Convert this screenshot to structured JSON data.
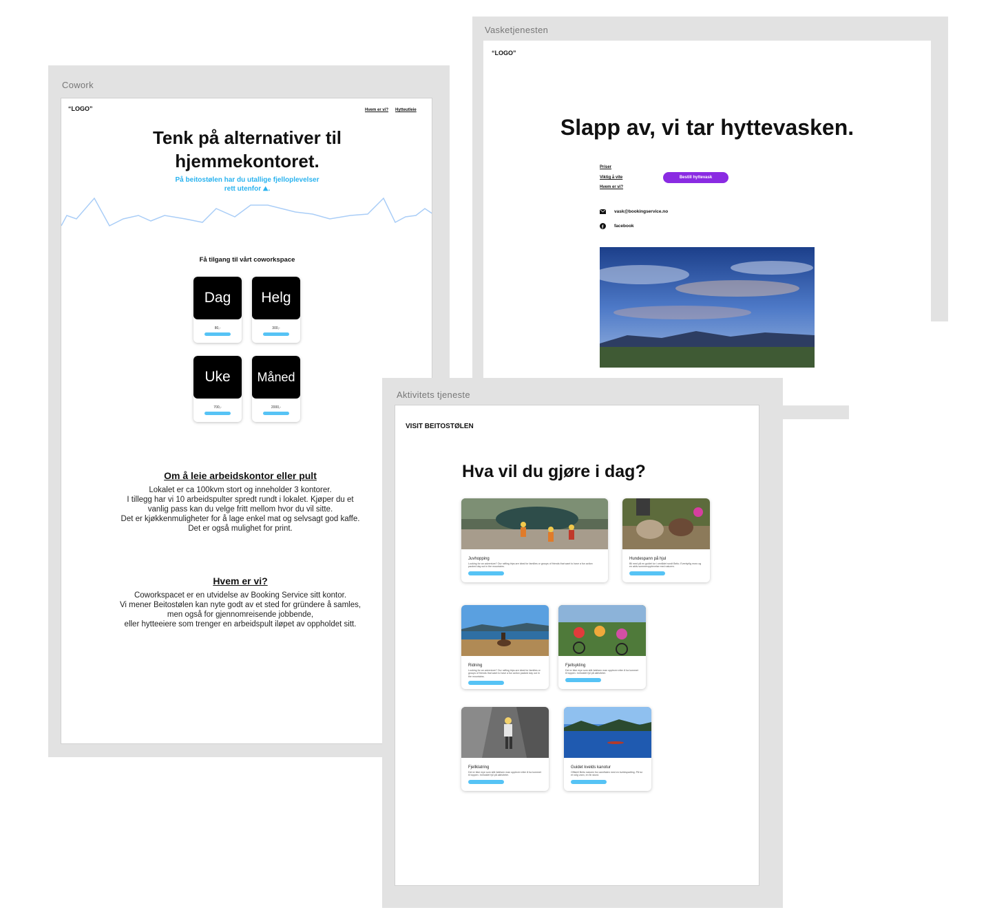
{
  "cowork": {
    "frame_title": "Cowork",
    "logo": "“LOGO”",
    "nav": [
      "Hvem er vi?",
      "Hytteutleie"
    ],
    "headline_line1": "Tenk på alternativer til",
    "headline_line2": "hjemmekontoret.",
    "subtitle_line1": "På beitostølen har du utallige fjelloplevelser",
    "subtitle_line2": "rett utenfor",
    "subtitle_end": ".",
    "access_heading": "Få tilgang til vårt coworkspace",
    "plans": [
      {
        "name": "Dag",
        "price": "80,-"
      },
      {
        "name": "Helg",
        "price": "300,-"
      },
      {
        "name": "Uke",
        "price": "700,-"
      },
      {
        "name": "Måned",
        "price": "2000,-"
      }
    ],
    "about_heading": "Om å leie arbeidskontor eller pult",
    "about_lines": [
      "Lokalet er ca 100kvm stort og inneholder 3 kontorer.",
      "I tillegg har vi 10 arbeidspulter spredt rundt i lokalet. Kjøper du et",
      "vanlig pass kan du velge fritt mellom hvor du vil sitte.",
      "Det er kjøkkenmuligheter for å lage enkel mat og selvsagt god kaffe.",
      "Det er også mulighet for print."
    ],
    "who_heading": "Hvem er vi?",
    "who_lines": [
      "Coworkspacet er en utvidelse av Booking Service sitt kontor.",
      "Vi mener Beitostølen kan nyte godt av et sted for gründere å samles,",
      "men også for gjennomreisende jobbende,",
      "eller hytteeiere som trenger en arbeidspult iløpet av oppholdet sitt."
    ]
  },
  "vask": {
    "frame_title": "Vasketjenesten",
    "logo": "“LOGO”",
    "headline": "Slapp av, vi tar hyttevasken.",
    "links": [
      "Priser",
      "Viktig å vite",
      "Hvem er vi?"
    ],
    "cta": "Bestill hyttevask",
    "email": "vask@bookingservice.no",
    "facebook": "facebook",
    "accent": "#8a2be2"
  },
  "aktivitet": {
    "frame_title": "Aktivitets tjeneste",
    "logo": "VISIT BEITOSTØLEN",
    "headline": "Hva vil du gjøre i dag?",
    "activities": [
      {
        "title": "Juvhopping",
        "desc": "Looking for an adventure? Our rafting trips are ideal for families or groups of friends that want to have a fun action packed day out in the mountains."
      },
      {
        "title": "Hundespann på hjul",
        "desc": "Bli med på en guidet tur i området rundt Beito. Eventyrlig moro og en aktiv sommeropplevelse med naturen."
      },
      {
        "title": "Ridning",
        "desc": "Looking for an adventure? Our rafting trips are ideal for families or groups of friends that want to have a fun action packed day out in the mountains."
      },
      {
        "title": "Fjellsykling",
        "desc": "Det er ikke mye som slår følelsen man opplever etter å ha kommet til toppen. Innholdet fyll på aktiviteter."
      },
      {
        "title": "Fjellklatring",
        "desc": "Det er ikke mye som slår følelsen man opplever etter å ha kommet til toppen. Innholdet fyll på aktiviteter."
      },
      {
        "title": "Guidet kvelds kanotur",
        "desc": "Offisiell Beito naturen fra vannflaten med en kveldspadling. På tur et rolig vann, en fin stund."
      }
    ],
    "button_color": "#56c3f5"
  }
}
